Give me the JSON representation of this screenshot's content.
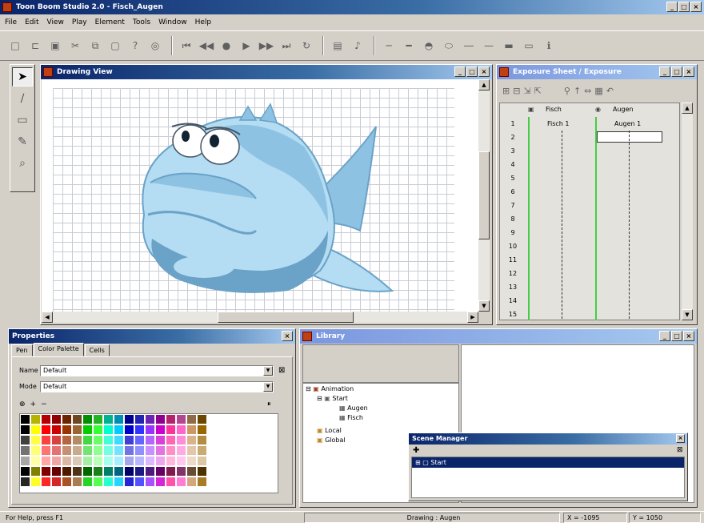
{
  "app": {
    "title": "Toon Boom Studio 2.0 - Fisch_Augen",
    "window_buttons": [
      "_",
      "□",
      "×"
    ]
  },
  "menu": [
    "File",
    "Edit",
    "View",
    "Play",
    "Element",
    "Tools",
    "Window",
    "Help"
  ],
  "drawing_view": {
    "title": "Drawing View"
  },
  "exposure_sheet": {
    "title": "Exposure Sheet / Exposure",
    "columns": [
      {
        "name": "Fisch",
        "element": "Fisch 1"
      },
      {
        "name": "Augen",
        "element": "Augen 1"
      }
    ],
    "rows": [
      "1",
      "2",
      "3",
      "4",
      "5",
      "6",
      "7",
      "8",
      "9",
      "10",
      "11",
      "12",
      "13",
      "14",
      "15"
    ]
  },
  "properties": {
    "title": "Properties",
    "tabs": [
      "Pen",
      "Color Palette",
      "Cells"
    ],
    "name_label": "Name",
    "name_value": "Default",
    "mode_label": "Mode",
    "mode_value": "Default"
  },
  "library": {
    "title": "Library",
    "tree": [
      {
        "label": "Animation",
        "level": 0,
        "expander": "⊟"
      },
      {
        "label": "Start",
        "level": 1,
        "expander": "⊟"
      },
      {
        "label": "Augen",
        "level": 2,
        "expander": ""
      },
      {
        "label": "Fisch",
        "level": 2,
        "expander": ""
      },
      {
        "label": "Local",
        "level": 0,
        "expander": ""
      },
      {
        "label": "Global",
        "level": 0,
        "expander": ""
      }
    ]
  },
  "scene_manager": {
    "title": "Scene Manager",
    "scene": "Start"
  },
  "status": {
    "help": "For Help, press F1",
    "mode": "Drawing : Augen",
    "x": "X = -1095",
    "y": "Y = 1050"
  },
  "colors": {
    "accent": "#0a246a",
    "fish_light": "#b4dcf2",
    "fish_mid": "#8ec2e2",
    "fish_dark": "#6aa2c8"
  },
  "palette": [
    "#000000",
    "#ffff00",
    "#ff0000",
    "#cc0000",
    "#993300",
    "#996633",
    "#00cc00",
    "#33ff33",
    "#00ffcc",
    "#00ccff",
    "#0000cc",
    "#3333ff",
    "#9933ff",
    "#cc00cc",
    "#ff3399",
    "#ff66cc",
    "#cc9966",
    "#996600"
  ]
}
